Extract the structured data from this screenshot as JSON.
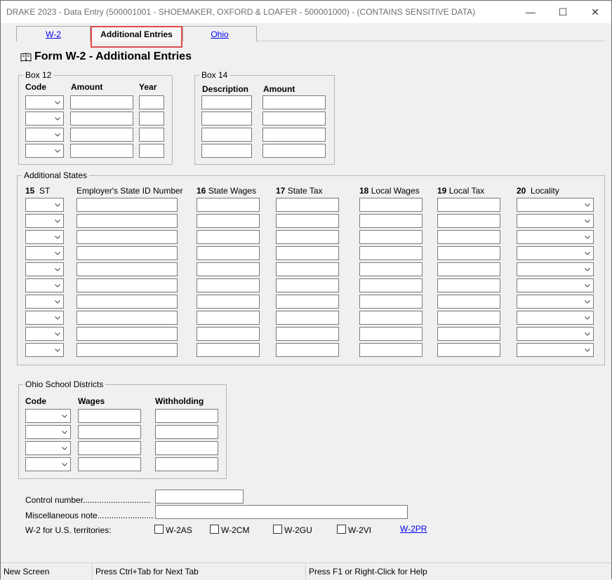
{
  "window": {
    "title": "DRAKE 2023 - Data Entry (500001001 - SHOEMAKER, OXFORD & LOAFER - 500001000) - (CONTAINS SENSITIVE DATA)",
    "minimize": "—",
    "maximize": "☐",
    "close": "✕"
  },
  "tabs": [
    {
      "label": "W-2"
    },
    {
      "label": "Additional Entries"
    },
    {
      "label": "Ohio"
    }
  ],
  "form": {
    "title": "Form W-2 - Additional Entries"
  },
  "box12": {
    "legend": "Box 12",
    "col_code": "Code",
    "col_amount": "Amount",
    "col_year": "Year"
  },
  "box14": {
    "legend": "Box 14",
    "col_description": "Description",
    "col_amount": "Amount"
  },
  "states": {
    "legend": "Additional States",
    "c15_num": "15",
    "c15_label": "ST",
    "employer_id_label": "Employer's State ID Number",
    "c16_num": "16",
    "c16_label": "State Wages",
    "c17_num": "17",
    "c17_label": "State Tax",
    "c18_num": "18",
    "c18_label": "Local Wages",
    "c19_num": "19",
    "c19_label": "Local Tax",
    "c20_num": "20",
    "c20_label": "Locality"
  },
  "ohio": {
    "legend": "Ohio School Districts",
    "col_code": "Code",
    "col_wages": "Wages",
    "col_withholding": "Withholding"
  },
  "misc": {
    "control_number_label": "Control number.............................",
    "misc_note_label": "Miscellaneous note........................",
    "territories_label": "W-2 for U.S. territories:",
    "territories": [
      {
        "label": "W-2AS"
      },
      {
        "label": "W-2CM"
      },
      {
        "label": "W-2GU"
      },
      {
        "label": "W-2VI"
      }
    ],
    "w2pr_link": "W-2PR"
  },
  "status": {
    "left": "New Screen",
    "middle": "Press Ctrl+Tab for Next Tab",
    "right": "Press F1 or Right-Click for Help"
  },
  "colors": {
    "highlight": "#e04b4b",
    "link": "#0000ee",
    "background": "#f0f0f0"
  }
}
